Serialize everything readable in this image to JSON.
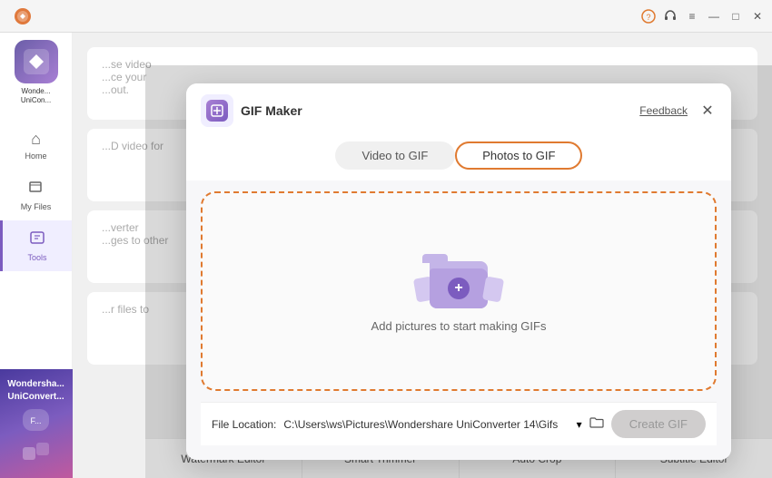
{
  "titleBar": {
    "appName": "Wondershare\nUniConverter",
    "buttons": {
      "minimize": "—",
      "maximize": "□",
      "close": "✕"
    },
    "icons": {
      "support": "?",
      "headphone": "🎧",
      "menu": "☰"
    }
  },
  "sidebar": {
    "items": [
      {
        "label": "Home",
        "icon": "⌂",
        "active": false
      },
      {
        "label": "My Files",
        "icon": "📁",
        "active": false
      },
      {
        "label": "Tools",
        "icon": "🧰",
        "active": true
      }
    ],
    "promo": {
      "line1": "Wondersha...",
      "line2": "UniConvert...",
      "badge": "F..."
    }
  },
  "gifMaker": {
    "title": "GIF Maker",
    "feedback": "Feedback",
    "tabs": [
      {
        "label": "Video to GIF",
        "active": false
      },
      {
        "label": "Photos to GIF",
        "active": true
      }
    ],
    "dropZone": {
      "text": "Add pictures to start making GIFs"
    },
    "fileLocation": {
      "label": "File Location:",
      "path": "C:\\Users\\ws\\Pictures\\Wondershare UniConverter 14\\Gifs"
    },
    "createButton": "Create GIF"
  },
  "bottomToolbar": {
    "items": [
      "Watermark Editor",
      "Smart Trimmer",
      "Auto Crop",
      "Subtitle Editor"
    ]
  },
  "mainCards": [
    {
      "text": "...se video\nice your\nout."
    },
    {
      "text": "...D video for"
    },
    {
      "text": "...verter\nges to other"
    },
    {
      "text": "...r files to"
    }
  ]
}
